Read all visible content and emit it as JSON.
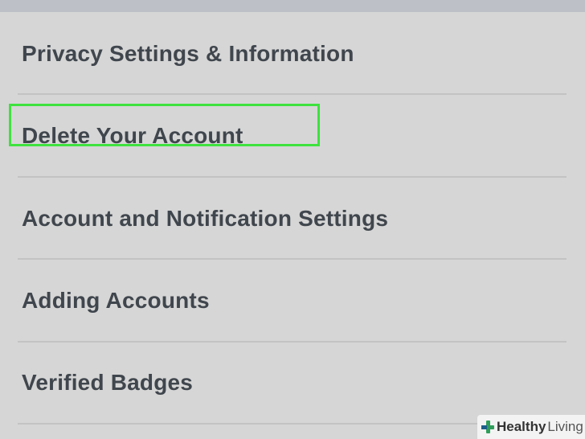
{
  "menu": {
    "items": [
      {
        "label": "Privacy Settings & Information"
      },
      {
        "label": "Delete Your Account",
        "highlighted": true
      },
      {
        "label": "Account and Notification Settings"
      },
      {
        "label": "Adding Accounts"
      },
      {
        "label": "Verified Badges"
      }
    ]
  },
  "highlight": {
    "color": "#3ee23e"
  },
  "watermark": {
    "brand_bold": "Healthy",
    "brand_rest": "Living",
    "icon": "medical-cross-icon"
  },
  "colors": {
    "background": "#d6d6d6",
    "text": "#40464d",
    "divider": "#c3c3c3",
    "top_strip": "#bdc0c7"
  }
}
